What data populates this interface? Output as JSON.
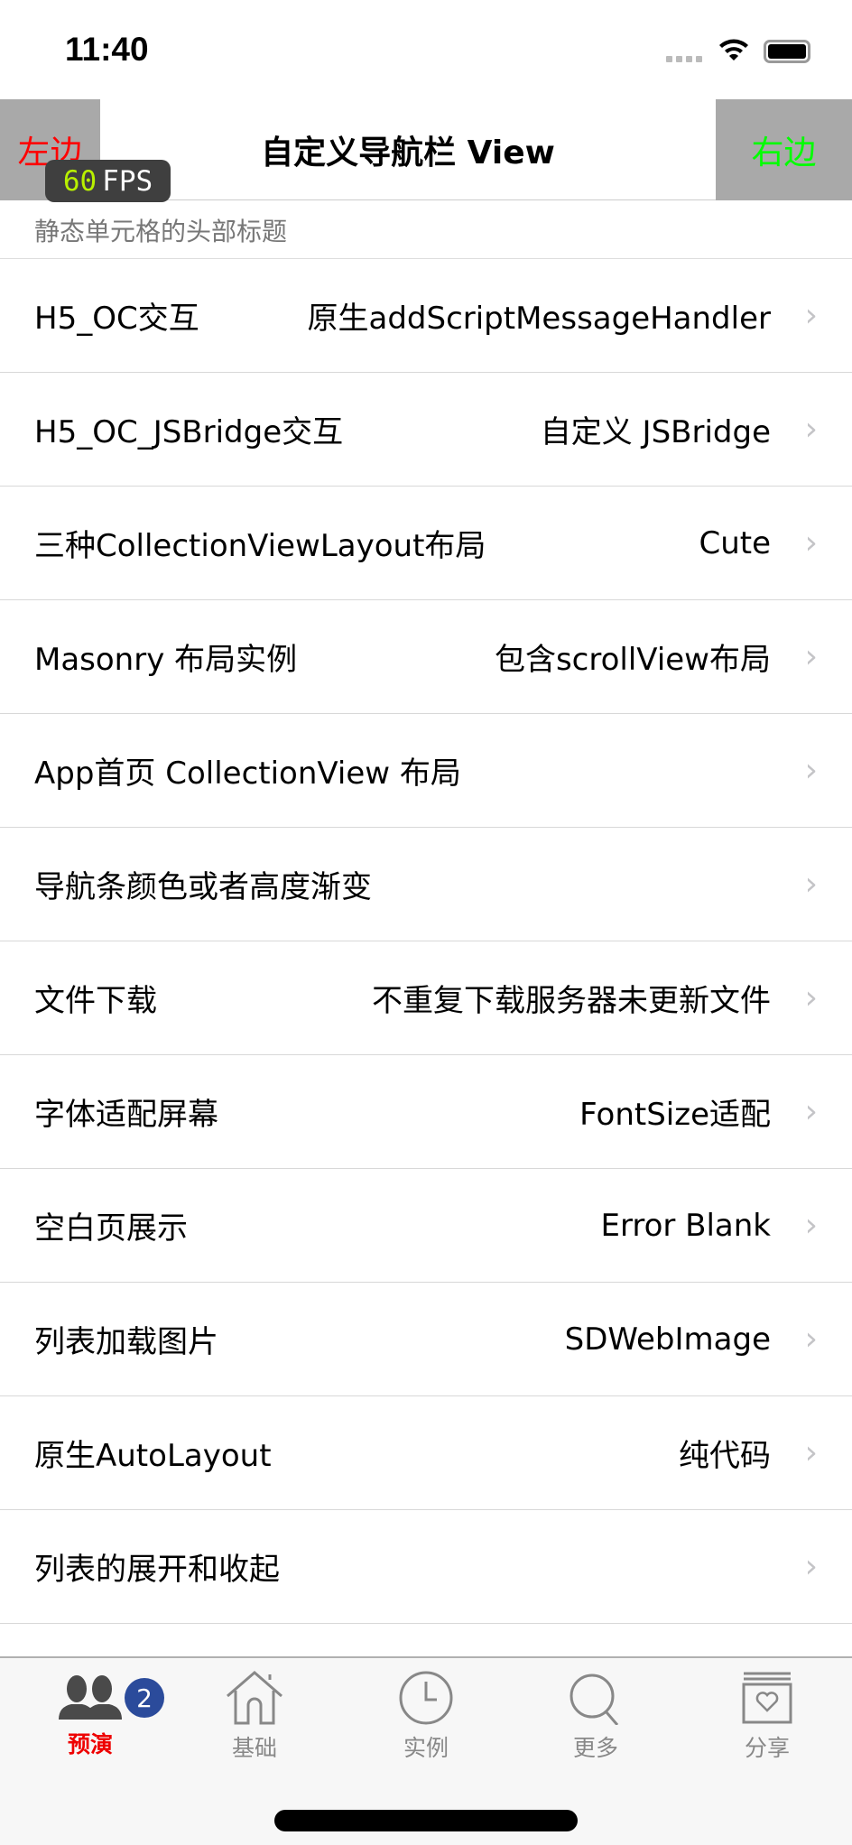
{
  "status_bar": {
    "time": "11:40"
  },
  "nav": {
    "left": "左边",
    "title": "自定义导航栏 View",
    "right": "右边"
  },
  "fps": {
    "value": "60",
    "unit": "FPS"
  },
  "section_header": "静态单元格的头部标题",
  "rows": [
    {
      "title": "H5_OC交互",
      "detail": "原生addScriptMessageHandler"
    },
    {
      "title": "H5_OC_JSBridge交互",
      "detail": "自定义 JSBridge"
    },
    {
      "title": "三种CollectionViewLayout布局",
      "detail": "Cute"
    },
    {
      "title": "Masonry 布局实例",
      "detail": "包含scrollView布局"
    },
    {
      "title": "App首页 CollectionView 布局",
      "detail": ""
    },
    {
      "title": "导航条颜色或者高度渐变",
      "detail": ""
    },
    {
      "title": "文件下载",
      "detail": "不重复下载服务器未更新文件"
    },
    {
      "title": "字体适配屏幕",
      "detail": "FontSize适配"
    },
    {
      "title": "空白页展示",
      "detail": "Error Blank"
    },
    {
      "title": "列表加载图片",
      "detail": "SDWebImage"
    },
    {
      "title": "原生AutoLayout",
      "detail": "纯代码"
    },
    {
      "title": "列表的展开和收起",
      "detail": ""
    }
  ],
  "chevron": "›",
  "tabs": [
    {
      "label": "预演",
      "icon": "people-icon",
      "badge": "2",
      "active": true
    },
    {
      "label": "基础",
      "icon": "house-icon"
    },
    {
      "label": "实例",
      "icon": "clock-icon"
    },
    {
      "label": "更多",
      "icon": "search-icon"
    },
    {
      "label": "分享",
      "icon": "heart-box-icon"
    }
  ],
  "colors": {
    "left": "#ff0000",
    "right": "#00ff00",
    "active_tab": "#ee0000",
    "badge": "#2b4b9b"
  }
}
